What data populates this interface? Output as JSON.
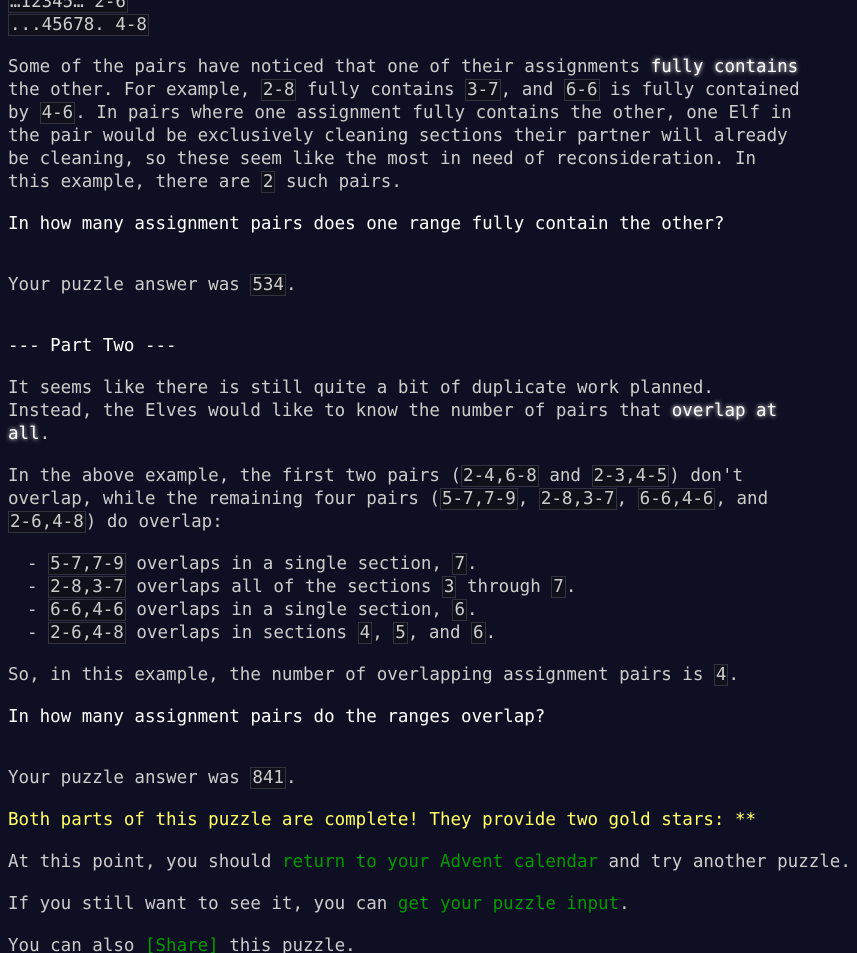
{
  "pre_top": "...45678.  4-8",
  "pre_cut": "…12345…  2-6",
  "part1": {
    "para": {
      "t1": "Some of the pairs have noticed that one of their assignments ",
      "em": "fully contains",
      "t2": "the other. For example, ",
      "c1": "2-8",
      "t3": " fully contains ",
      "c2": "3-7",
      "t4": ", and ",
      "c3": "6-6",
      "t5": " is fully contained",
      "t6": "by ",
      "c4": "4-6",
      "t7": ". In pairs where one assignment fully contains the other, one Elf in",
      "l4": "the pair would be exclusively cleaning sections their partner will already",
      "l5": "be cleaning, so these seem like the most in need of reconsideration. In",
      "t8": "this example, there are ",
      "c5": "2",
      "t9": " such pairs."
    },
    "question": "In how many assignment pairs does one range fully contain the other?",
    "answer_prefix": "Your puzzle answer was ",
    "answer": "534",
    "answer_suffix": "."
  },
  "part2": {
    "heading": "--- Part Two ---",
    "intro": {
      "l1": "It seems like there is still quite a bit of duplicate work planned.",
      "t1": "Instead, the Elves would like to know the number of pairs that ",
      "em1": "overlap at",
      "em2": "all",
      "t2": "."
    },
    "example": {
      "t1": "In the above example, the first two pairs (",
      "c1": "2-4,6-8",
      "t2": " and ",
      "c2": "2-3,4-5",
      "t3": ") don't",
      "t4": "overlap, while the remaining four pairs (",
      "c3": "5-7,7-9",
      "t5": ", ",
      "c4": "2-8,3-7",
      "t6": ", ",
      "c5": "6-6,4-6",
      "t7": ", and",
      "c6": "2-6,4-8",
      "t8": ") do overlap:"
    },
    "list": [
      {
        "c": "5-7,7-9",
        "t1": " overlaps in a single section, ",
        "v1": "7",
        "t2": "."
      },
      {
        "c": "2-8,3-7",
        "t1": " overlaps all of the sections ",
        "v1": "3",
        "t2": " through ",
        "v2": "7",
        "t3": "."
      },
      {
        "c": "6-6,4-6",
        "t1": " overlaps in a single section, ",
        "v1": "6",
        "t2": "."
      },
      {
        "c": "2-6,4-8",
        "t1": " overlaps in sections ",
        "v1": "4",
        "t2": ", ",
        "v2": "5",
        "t3": ", and ",
        "v3": "6",
        "t4": "."
      }
    ],
    "summary_prefix": "So, in this example, the number of overlapping assignment pairs is ",
    "summary_value": "4",
    "summary_suffix": ".",
    "question": "In how many assignment pairs do the ranges overlap?",
    "answer_prefix": "Your puzzle answer was ",
    "answer": "841",
    "answer_suffix": "."
  },
  "footer": {
    "complete": "Both parts of this puzzle are complete! They provide two gold stars: **",
    "l2_t1": "At this point, you should ",
    "l2_link": "return to your Advent calendar",
    "l2_t2": " and try another puzzle.",
    "l3_t1": "If you still want to see it, you can ",
    "l3_link": "get your puzzle input",
    "l3_t2": ".",
    "l4_t1": "You can also ",
    "l4_link": "[Share]",
    "l4_t2": " this puzzle."
  },
  "colors": {
    "background": "#0f0f23",
    "text": "#cccccc",
    "link": "#009900",
    "gold": "#ffff66",
    "emphasis": "#ffffff"
  }
}
